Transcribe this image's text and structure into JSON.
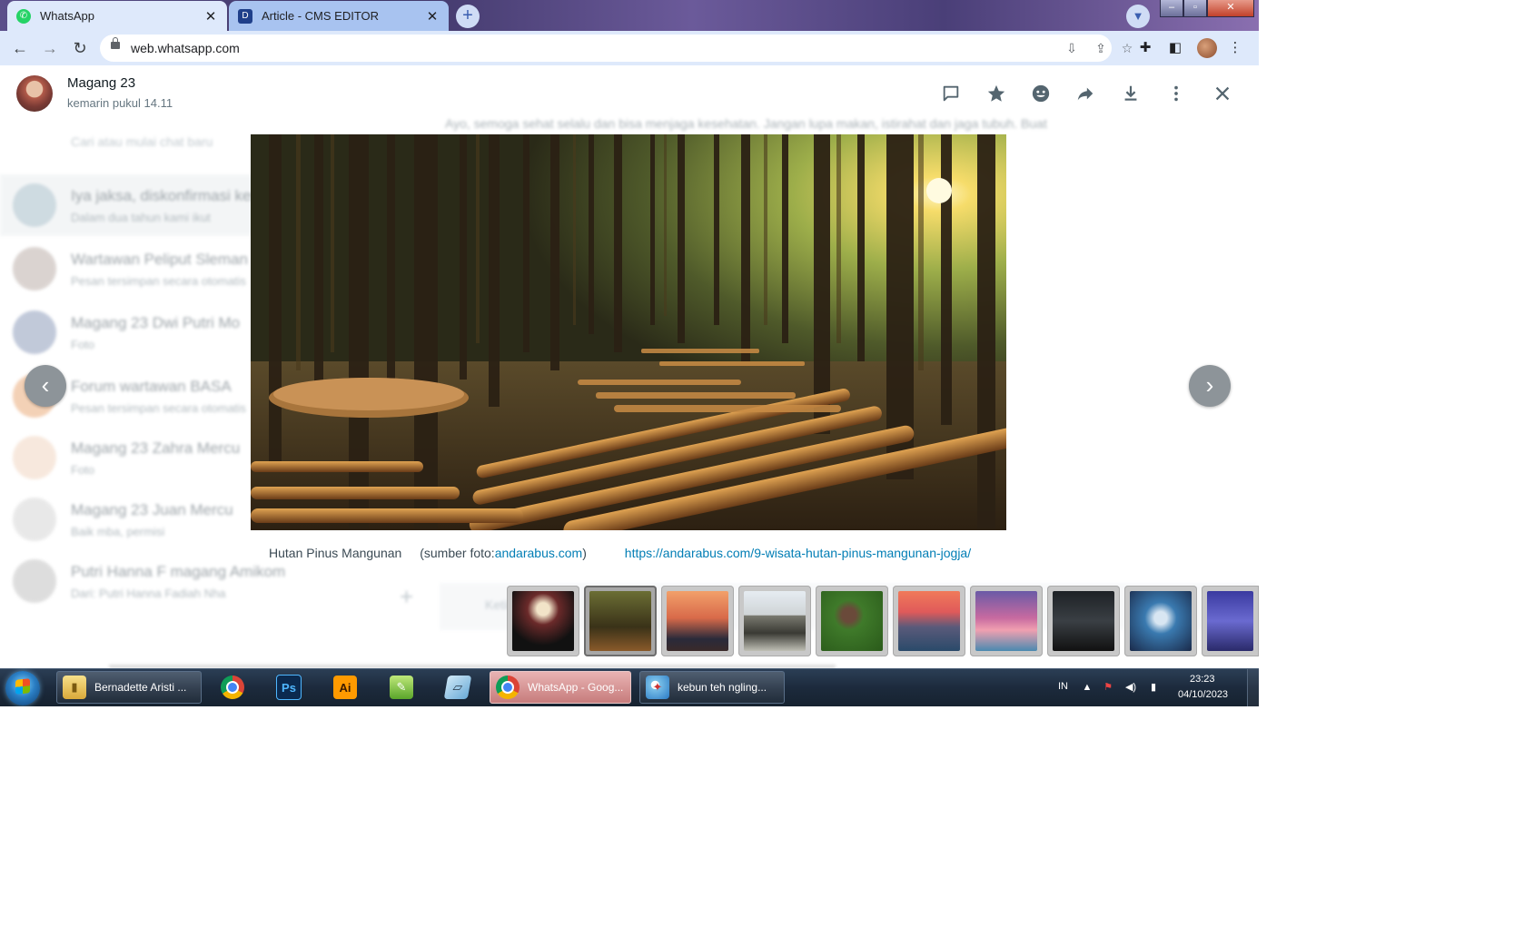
{
  "browser": {
    "tabs": [
      {
        "title": "WhatsApp",
        "icon": "whatsapp-icon",
        "active": true
      },
      {
        "title": "Article - CMS EDITOR",
        "icon": "cms-icon",
        "active": false
      }
    ],
    "new_tab": "+",
    "url": "web.whatsapp.com",
    "window_controls": {
      "minimize": "–",
      "maximize": "▫",
      "close": "✕"
    }
  },
  "viewer": {
    "sender_name": "Magang 23",
    "sender_time": "kemarin pukul 14.11",
    "header_icons": [
      "chat-icon",
      "star-icon",
      "emoji-icon",
      "forward-icon",
      "download-icon",
      "menu-icon",
      "close-icon"
    ],
    "caption": {
      "title": "Hutan Pinus Mangunan",
      "source_prefix": "(sumber foto:",
      "source_link": "andarabus.com",
      "source_suffix": ")",
      "url": "https://andarabus.com/9-wisata-hutan-pinus-mangunan-jogja/"
    },
    "thumbnails": [
      {
        "name": "concert-stage-photo",
        "active": false
      },
      {
        "name": "pine-forest-photo",
        "active": true
      },
      {
        "name": "sunset-beach-photo",
        "active": false
      },
      {
        "name": "white-gate-building-photo",
        "active": false
      },
      {
        "name": "tea-garden-photo",
        "active": false
      },
      {
        "name": "mountain-viewpoint-photo",
        "active": false
      },
      {
        "name": "pink-beach-palms-photo",
        "active": false
      },
      {
        "name": "movie-poster-photo",
        "active": false
      },
      {
        "name": "fantasy-character-photo",
        "active": false
      },
      {
        "name": "stage-crowd-photo",
        "active": false
      }
    ]
  },
  "background_chats": {
    "search_placeholder": "Cari atau mulai chat baru",
    "chat_preview": "Ayo, semoga sehat selalu dan bisa menjaga kesehatan. Jangan lupa makan, istirahat dan jaga tubuh. Buat",
    "chats": [
      {
        "title": "Iya jaksa, diskonfirmasi kesan",
        "sub": "Dalam dua tahun kami ikut"
      },
      {
        "title": "Wartawan Peliput Sleman",
        "sub": "Pesan tersimpan secara otomatis"
      },
      {
        "title": "Magang 23 Dwi Putri Mo",
        "sub": "Foto"
      },
      {
        "title": "Forum wartawan BASA",
        "sub": "Pesan tersimpan secara otomatis"
      },
      {
        "title": "Magang 23 Zahra Mercu",
        "sub": "Foto"
      },
      {
        "title": "Magang 23 Juan Mercu",
        "sub": "Baik mba, permisi"
      },
      {
        "title": "Putri Hanna F magang Amikom",
        "sub": "Dari: Putri Hanna Fadiah Nha"
      }
    ],
    "message_input": "Ketik pesan"
  },
  "taskbar": {
    "items": [
      {
        "label": "Bernadette Aristi ...",
        "icon": "folder-icon",
        "wide": true
      },
      {
        "label": "",
        "icon": "chrome-icon",
        "wide": false
      },
      {
        "label": "Ps",
        "icon": "photoshop-icon",
        "wide": false
      },
      {
        "label": "Ai",
        "icon": "illustrator-icon",
        "wide": false
      },
      {
        "label": "",
        "icon": "coreldraw-icon",
        "wide": false
      },
      {
        "label": "",
        "icon": "notes-icon",
        "wide": false
      },
      {
        "label": "WhatsApp - Goog...",
        "icon": "chrome-icon",
        "wide": true,
        "active": true
      },
      {
        "label": "kebun teh ngling...",
        "icon": "paint-icon",
        "wide": true
      }
    ],
    "tray": {
      "language": "IN",
      "time": "23:23",
      "date": "04/10/2023"
    }
  },
  "colors": {
    "accent_link": "#027eb5",
    "tab_active": "#dee9fb",
    "taskbar_active": "#c77c7c"
  }
}
